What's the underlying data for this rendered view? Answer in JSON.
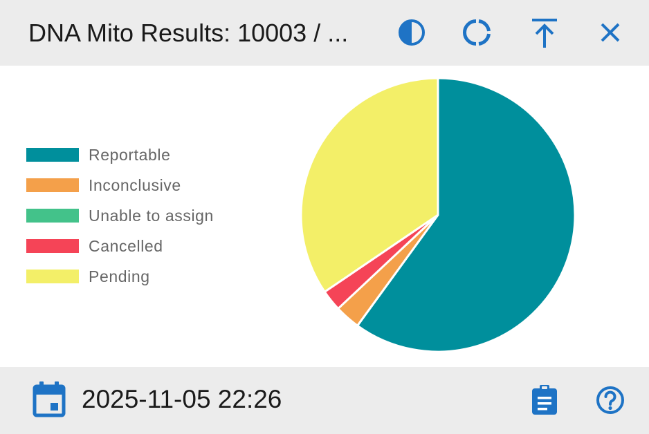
{
  "header": {
    "title": "DNA Mito Results: 10003 / ...",
    "buttons": [
      {
        "name": "contrast-toggle-button",
        "icon": "contrast-icon"
      },
      {
        "name": "donut-toggle-button",
        "icon": "donut-chart-icon"
      },
      {
        "name": "pin-top-button",
        "icon": "vertical-align-top-icon"
      },
      {
        "name": "close-button",
        "icon": "close-icon"
      }
    ]
  },
  "chart_data": {
    "type": "pie",
    "categories": [
      "Reportable",
      "Inconclusive",
      "Unable to assign",
      "Cancelled",
      "Pending"
    ],
    "values": [
      60,
      3,
      0,
      2.5,
      34.5
    ],
    "colors": [
      "#008f9c",
      "#f4a04a",
      "#43c28a",
      "#f54457",
      "#f3ef68"
    ],
    "legend_position": "left"
  },
  "footer": {
    "date": "2025-11-05 22:26",
    "left_icon": "calendar-icon",
    "right_icons": [
      "clipboard-icon",
      "help-icon"
    ]
  },
  "accent_color": "#1e73c5"
}
